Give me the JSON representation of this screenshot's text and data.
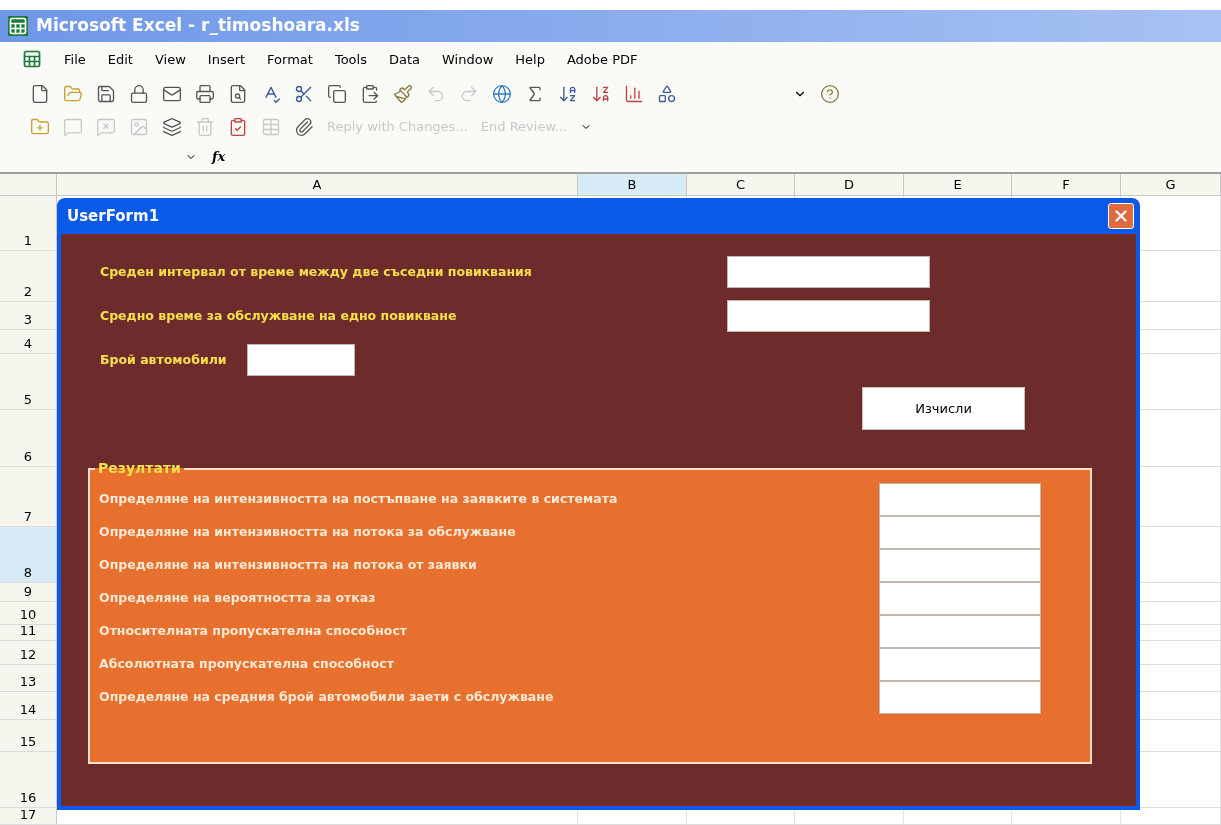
{
  "window": {
    "title": "Microsoft Excel - r_timoshoara.xls"
  },
  "menu": [
    "File",
    "Edit",
    "View",
    "Insert",
    "Format",
    "Tools",
    "Data",
    "Window",
    "Help",
    "Adobe PDF"
  ],
  "reviewing_toolbar": [
    {
      "label": "Reply with Changes...",
      "disabled": true
    },
    {
      "label": "End Review...",
      "disabled": true
    }
  ],
  "formula_bar": {
    "function_symbol": "fx"
  },
  "columns": [
    {
      "label": "A",
      "selected": false
    },
    {
      "label": "B",
      "selected": true
    },
    {
      "label": "C",
      "selected": false
    },
    {
      "label": "D",
      "selected": false
    },
    {
      "label": "E",
      "selected": false
    },
    {
      "label": "F",
      "selected": false
    },
    {
      "label": "G",
      "selected": false
    }
  ],
  "rows": [
    {
      "label": "1",
      "selected": false
    },
    {
      "label": "2",
      "selected": false
    },
    {
      "label": "3",
      "selected": false
    },
    {
      "label": "4",
      "selected": false
    },
    {
      "label": "5",
      "selected": false
    },
    {
      "label": "6",
      "selected": false
    },
    {
      "label": "7",
      "selected": false
    },
    {
      "label": "8",
      "selected": true
    },
    {
      "label": "9",
      "selected": false
    },
    {
      "label": "10",
      "selected": false
    },
    {
      "label": "11",
      "selected": false
    },
    {
      "label": "12",
      "selected": false
    },
    {
      "label": "13",
      "selected": false
    },
    {
      "label": "14",
      "selected": false
    },
    {
      "label": "15",
      "selected": false
    },
    {
      "label": "16",
      "selected": false
    },
    {
      "label": "17",
      "selected": false
    }
  ],
  "dialog": {
    "title": "UserForm1",
    "inputs": [
      {
        "label": "Среден интервал от време между две съседни повиквания"
      },
      {
        "label": "Средно време за обслужване на едно повикване"
      },
      {
        "label": "Брой автомобили"
      }
    ],
    "button": "Изчисли",
    "results": {
      "title": "Резултати",
      "items": [
        {
          "label": "Определяне на интензивността на постъпване на заявките в системата"
        },
        {
          "label": "Определяне на интензивността на потока за обслужване"
        },
        {
          "label": "Определяне на интензивността на потока от заявки"
        },
        {
          "label": "Определяне на вероятността за отказ"
        },
        {
          "label": "Относителната пропускателна способност"
        },
        {
          "label": "Абсолютната пропускателна способност"
        },
        {
          "label": "Определяне на средния брой автомобили заети с обслужване"
        }
      ]
    }
  }
}
